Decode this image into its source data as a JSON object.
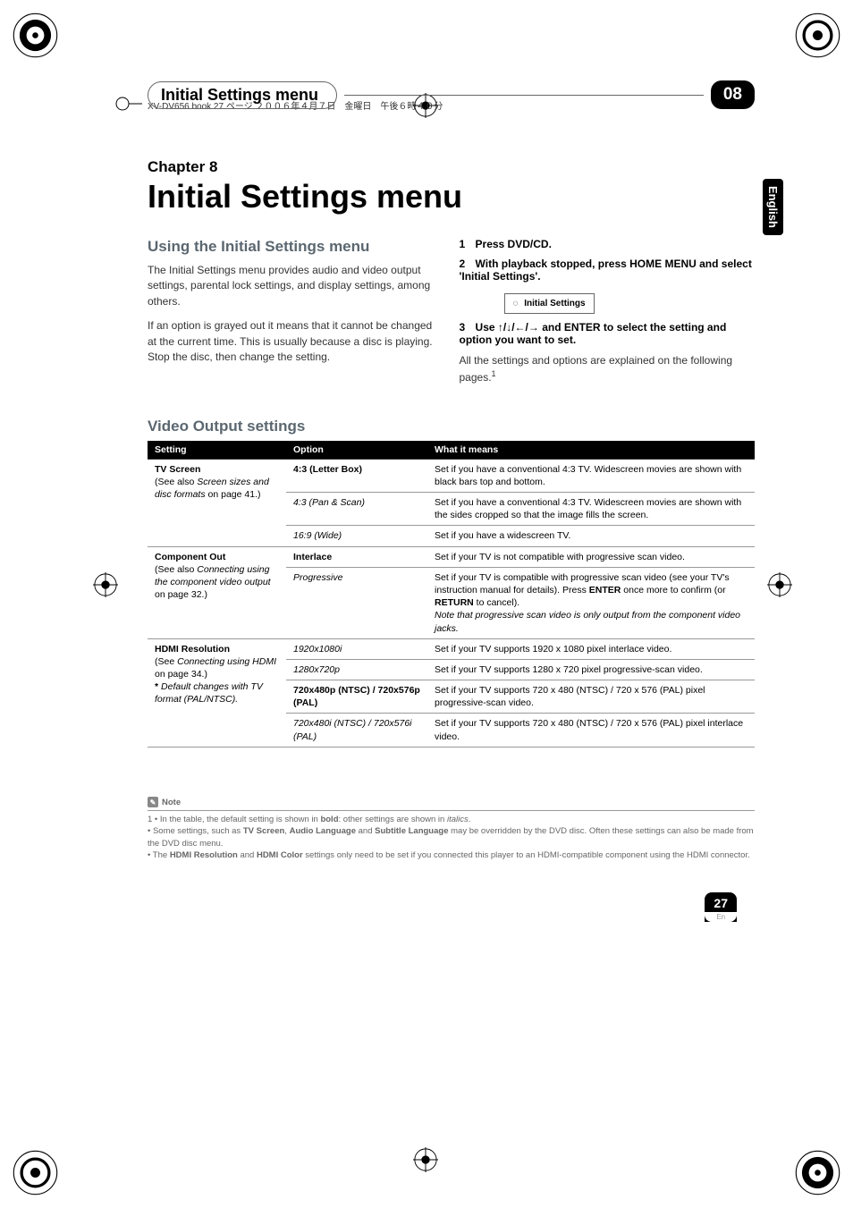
{
  "book_meta": "XV-DV656.book 27 ページ ２００６年４月７日　金曜日　午後６時４０分",
  "header": {
    "title": "Initial Settings menu",
    "chapter_num": "08"
  },
  "side_tab": "English",
  "chapter_label": "Chapter 8",
  "main_title": "Initial Settings menu",
  "left": {
    "heading": "Using the Initial Settings menu",
    "p1": "The Initial Settings menu provides audio and video output settings, parental lock settings, and display settings, among others.",
    "p2": "If an option is grayed out it means that it cannot be changed at the current time. This is usually because a disc is playing. Stop the disc, then change the setting."
  },
  "right": {
    "s1_num": "1",
    "s1_text": "Press DVD/CD.",
    "s2_num": "2",
    "s2_text": "With playback stopped, press HOME MENU and select 'Initial Settings'.",
    "box_label": "Initial Settings",
    "s3_num": "3",
    "s3_pre": "Use ",
    "s3_arrows": "↑/↓/←/→",
    "s3_post": " and ENTER to select the setting and option you want to set.",
    "p3": "All the settings and options are explained on the following pages.",
    "sup": "1"
  },
  "table_heading": "Video Output settings",
  "thead": {
    "c1": "Setting",
    "c2": "Option",
    "c3": "What it means"
  },
  "rows": [
    {
      "setting_html": "<span class='bold'>TV Screen</span><br>(See also <span class='italic'>Screen sizes and disc formats</span> on page 41.)",
      "option_html": "<span class='bold'>4:3 (Letter Box)</span>",
      "meaning": "Set if you have a conventional 4:3 TV. Widescreen movies are shown with black bars top and bottom.",
      "thick": true
    },
    {
      "setting_html": "",
      "option_html": "<span class='italic'>4:3 (Pan & Scan)</span>",
      "meaning": "Set if you have a conventional 4:3 TV. Widescreen movies are shown with the sides cropped so that the image fills the screen."
    },
    {
      "setting_html": "",
      "option_html": "<span class='italic'>16:9 (Wide)</span>",
      "meaning": "Set if you have a widescreen TV."
    },
    {
      "setting_html": "<span class='bold'>Component Out</span><br>(See also <span class='italic'>Connecting using the component video output</span> on page 32.)",
      "option_html": "<span class='bold'>Interlace</span>",
      "meaning": "Set if your TV is not compatible with progressive scan video.",
      "thick": true
    },
    {
      "setting_html": "",
      "option_html": "<span class='italic'>Progressive</span>",
      "meaning": "Set if your TV is compatible with progressive scan video (see your TV's instruction manual for details). Press <span class='bold'>ENTER</span> once more to confirm (or <span class='bold'>RETURN</span> to cancel).<br><span class='italic'>Note that progressive scan video is only output from the component video jacks.</span>"
    },
    {
      "setting_html": "<span class='bold'>HDMI Resolution</span><br>(See <span class='italic'>Connecting using HDMI</span> on page 34.)<br><span class='bold'>*</span> <span class='italic'>Default changes with TV format (PAL/NTSC).</span>",
      "option_html": "<span class='italic'>1920x1080i</span>",
      "meaning": "Set if your TV supports 1920 x 1080 pixel interlace video.",
      "thick": true
    },
    {
      "setting_html": "",
      "option_html": "<span class='italic'>1280x720p</span>",
      "meaning": "Set if your TV supports 1280 x 720 pixel progressive-scan video."
    },
    {
      "setting_html": "",
      "option_html": "<span class='bold'>720x480p (NTSC) / 720x576p (PAL)</span>",
      "meaning": "Set if your TV supports 720 x 480 (NTSC) / 720 x 576 (PAL) pixel progressive-scan video."
    },
    {
      "setting_html": "",
      "option_html": "<span class='italic'>720x480i (NTSC) / 720x576i (PAL)</span>",
      "meaning": "Set if your TV supports 720 x 480 (NTSC) / 720 x 576 (PAL) pixel interlace video."
    }
  ],
  "note": {
    "label": "Note",
    "l1": "1 • In the table, the default setting is shown in <span class='bold'>bold</span>: other settings are shown in <span class='italic'>italics</span>.",
    "l2": "  • Some settings, such as <span class='bold'>TV Screen</span>, <span class='bold'>Audio Language</span> and <span class='bold'>Subtitle Language</span> may be overridden by the DVD disc. Often these settings can also be made from the DVD disc menu.",
    "l3": "  • The <span class='bold'>HDMI Resolution</span> and <span class='bold'>HDMI Color</span> settings only need to be set if you connected this player to an HDMI-compatible component using the HDMI connector."
  },
  "page_num": "27",
  "page_lang": "En"
}
